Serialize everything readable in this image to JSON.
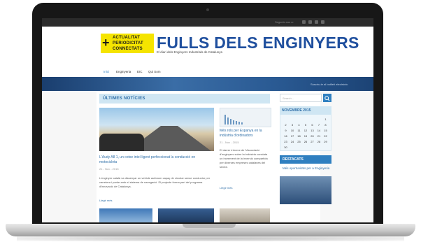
{
  "site": {
    "follow_label": "Segueix-nos a:",
    "logo_lines": [
      "ACTUALITAT",
      "PERIODICITAT",
      "CONNECTATS"
    ],
    "logo_plus": "+",
    "title": "FULLS DELS ENGINYERS",
    "subtitle": "El diari dels Enginyers Industrials de Catalunya",
    "nav": [
      "Inici",
      "Enginyeria",
      "EIC",
      "Qui Som"
    ],
    "banner_text": "Suscriu-te al butlletí electrònic",
    "section_title": "ÚLTIMES NOTÍCIES"
  },
  "articles": {
    "main": {
      "title": "L'Audy A8 1, un cotxe intel·ligent perfeccionat la conducció en motocicleta",
      "date": "21 - Nov - 2015",
      "body": "L'enginyer català va dissenyar un vehicle autònom capaç de circular sense conductor per carretera i parlar amb el sistema de navegació. El projecte forma part del programa d'innovació de Catalunya.",
      "more": "Llegir més"
    },
    "side": {
      "title": "Més rols per Espanya en la indústria d'ordinadors",
      "date": "21 - Nov - 2015",
      "body": "El darrer informe de l'Associació d'enginyers sobre la indústria constata un increment de la inversió compartida per diverses empreses catalanes del sector.",
      "more": "Llegir més"
    }
  },
  "sidebar": {
    "search_placeholder": "Search...",
    "calendar_title": "NOVEMBRE 2015",
    "calendar_days": [
      "1",
      "2",
      "3",
      "4",
      "5",
      "6",
      "7",
      "8",
      "9",
      "10",
      "11",
      "12",
      "13",
      "14",
      "15",
      "16",
      "17",
      "18",
      "19",
      "20",
      "21",
      "22",
      "23",
      "24",
      "25",
      "26",
      "27",
      "28",
      "29",
      "30"
    ],
    "featured_title": "DESTACATS",
    "featured_text": "Més oportunitats per a Enginyeria"
  },
  "colors": {
    "accent_blue": "#2f7fc0",
    "brand_blue": "#1f4f9e",
    "logo_yellow": "#f5e400"
  }
}
